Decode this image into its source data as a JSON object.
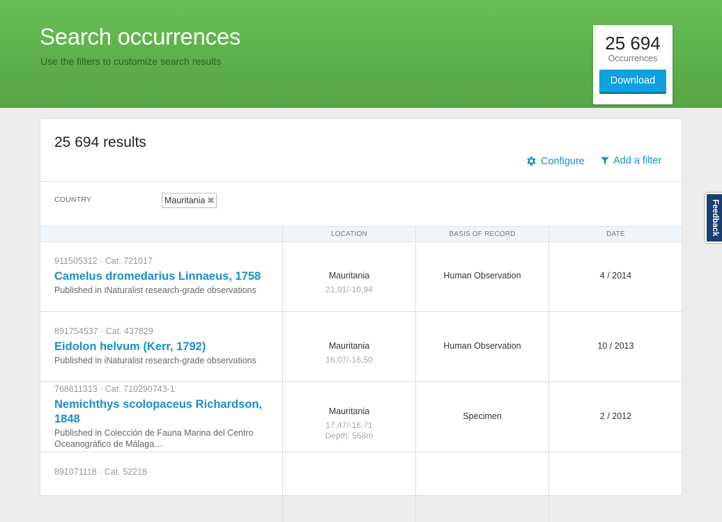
{
  "header": {
    "title": "Search occurrences",
    "subtitle": "Use the filters to customize search results"
  },
  "summary_card": {
    "count": "25 694",
    "label": "Occurrences",
    "download_label": "Download"
  },
  "results": {
    "count_text": "25 694 results",
    "configure_label": "Configure",
    "add_filter_label": "Add a filter"
  },
  "filters": {
    "label": "COUNTRY",
    "value": "Mauritania",
    "remove_glyph": "✖"
  },
  "table": {
    "columns": [
      "",
      "LOCATION",
      "BASIS OF RECORD",
      "DATE"
    ],
    "rows": [
      {
        "id": "911505312 · Cat. 721017",
        "name": "Camelus dromedarius Linnaeus, 1758",
        "published": "Published in iNaturalist research-grade observations",
        "country": "Mauritania",
        "coords": "21,01/-10,94",
        "depth": "",
        "basis": "Human Observation",
        "date": "4 / 2014"
      },
      {
        "id": "891754537 · Cat. 437829",
        "name": "Eidolon helvum (Kerr, 1792)",
        "published": "Published in iNaturalist research-grade observations",
        "country": "Mauritania",
        "coords": "16,07/-16,50",
        "depth": "",
        "basis": "Human Observation",
        "date": "10 / 2013"
      },
      {
        "id": "768611313 · Cat. 710290743-1",
        "name": "Nemichthys scolopaceus Richardson, 1848",
        "published": "Published in Colección de Fauna Marina del Centro Oceanográfico de Málaga…",
        "country": "Mauritania",
        "coords": "17,47/-16,71",
        "depth": "Depth: 558m",
        "basis": "Specimen",
        "date": "2 / 2012"
      },
      {
        "id": "891071118 · Cat. 52218",
        "name": "",
        "published": "",
        "country": "",
        "coords": "",
        "depth": "",
        "basis": "",
        "date": ""
      }
    ]
  },
  "feedback": {
    "label": "Feedback"
  },
  "colors": {
    "header_green": "#5db04a",
    "link_blue": "#1a8fc6",
    "button_blue": "#0fa0e0",
    "feedback_navy": "#1a3e6e"
  },
  "icons": {
    "configure": "gear-icon",
    "add_filter": "funnel-icon",
    "remove_filter": "close-icon"
  }
}
